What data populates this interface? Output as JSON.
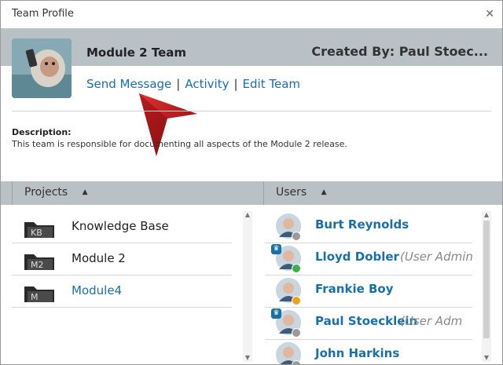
{
  "window": {
    "title": "Team Profile"
  },
  "team": {
    "name": "Module 2 Team",
    "created_by": "Created By: Paul Stoec...",
    "links": [
      "Send Message",
      "Activity",
      "Edit Team"
    ],
    "description_label": "Description:",
    "description": "This team is responsible for documenting all aspects of the Module 2 release."
  },
  "sections": {
    "projects_header": "Projects",
    "users_header": "Users",
    "sort_glyph": "▲"
  },
  "projects": [
    {
      "abbr": "KB",
      "label": "Knowledge Base",
      "link": false
    },
    {
      "abbr": "M2",
      "label": "Module 2",
      "link": false
    },
    {
      "abbr": "M",
      "label": "Module4",
      "link": true
    }
  ],
  "users": [
    {
      "name": "Burt Reynolds",
      "role": "",
      "admin": false,
      "status": "gray"
    },
    {
      "name": "Lloyd Dobler",
      "role": "(User Admin",
      "admin": true,
      "status": "green"
    },
    {
      "name": "Frankie Boy",
      "role": "",
      "admin": false,
      "status": "orange"
    },
    {
      "name": "Paul Stoecklein",
      "role": "(User Adm",
      "admin": true,
      "status": "gray"
    },
    {
      "name": "John Harkins",
      "role": "",
      "admin": false,
      "status": "gray"
    }
  ],
  "colors": {
    "link": "#1a6fa8",
    "header_bar": "#b9c1c4",
    "pointer": "#c0161a",
    "status_gray": "#9a9a9a",
    "status_green": "#3cb043",
    "status_orange": "#f0a020"
  },
  "icons": {
    "close": "close-icon",
    "folder": "folder-icon",
    "admin": "crown-icon"
  }
}
